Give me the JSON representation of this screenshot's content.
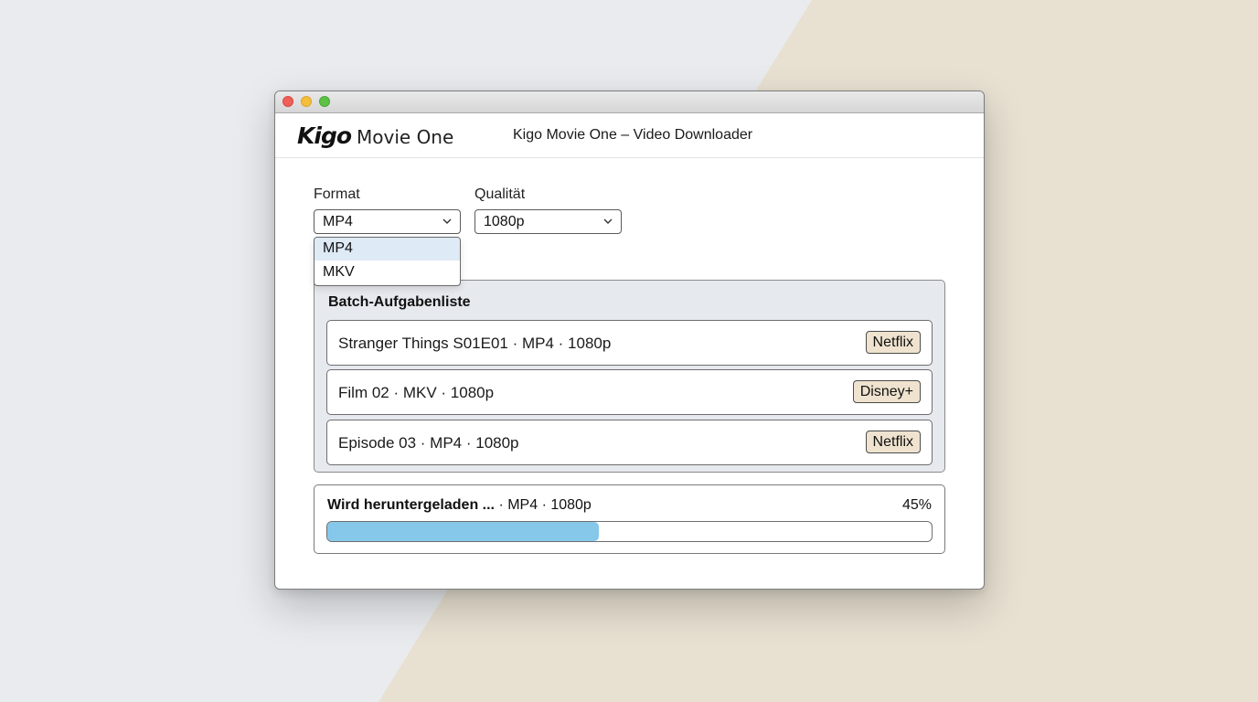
{
  "window": {
    "title": "Kigo Movie One – Video Downloader"
  },
  "logo": {
    "brand": "Kigo",
    "product": "Movie One"
  },
  "format": {
    "label": "Format",
    "selected": "MP4",
    "options": [
      "MP4",
      "MKV"
    ],
    "dropdown_open": true
  },
  "quality": {
    "label": "Qualität",
    "selected": "1080p"
  },
  "batch": {
    "title": "Batch-Aufgabenliste",
    "items": [
      {
        "text": "Stranger Things S01E01 · MP4 · 1080p",
        "source": "Netflix"
      },
      {
        "text": "Film 02 · MKV · 1080p",
        "source": "Disney+"
      },
      {
        "text": "Episode 03 · MP4 · 1080p",
        "source": "Netflix"
      }
    ]
  },
  "download": {
    "status": "Wird heruntergeladen ...",
    "details": " · MP4 · 1080p",
    "percent_label": "45%",
    "progress": 0.45
  },
  "colors": {
    "progress_fill": "#86c8ea",
    "badge_bg": "#efe3cf",
    "selected_option_bg": "#deeaf6",
    "panel_bg": "#e6e9ee",
    "traffic_close": "#ee5f58",
    "traffic_minimize": "#f4bd3a",
    "traffic_maximize": "#5dc146"
  },
  "icons": {
    "select_arrow": "chevron-down-icon"
  }
}
